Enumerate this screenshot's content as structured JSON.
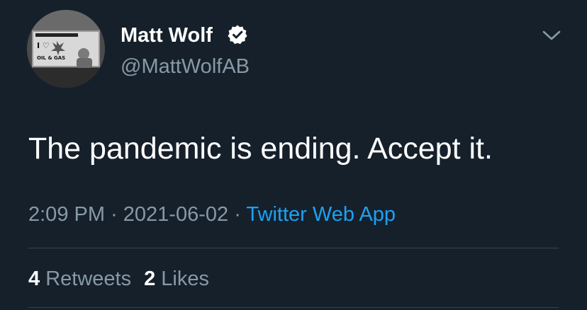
{
  "user": {
    "display_name": "Matt Wolf",
    "handle": "@MattWolfAB",
    "verified": true,
    "avatar_sign": {
      "line1": "I ♡",
      "line2": "OIL & GAS"
    }
  },
  "tweet": {
    "text": "The pandemic is ending. Accept it.",
    "time": "2:09 PM",
    "separator": "·",
    "date": "2021-06-02",
    "source": "Twitter Web App"
  },
  "stats": {
    "retweets_count": "4",
    "retweets_label": "Retweets",
    "likes_count": "2",
    "likes_label": "Likes"
  },
  "icons": {
    "verified": "verified-badge-icon",
    "menu": "chevron-down-icon"
  },
  "colors": {
    "background": "#15202b",
    "primary_text": "#ffffff",
    "secondary_text": "#8899a6",
    "link": "#1da1f2",
    "divider": "#38444d"
  }
}
